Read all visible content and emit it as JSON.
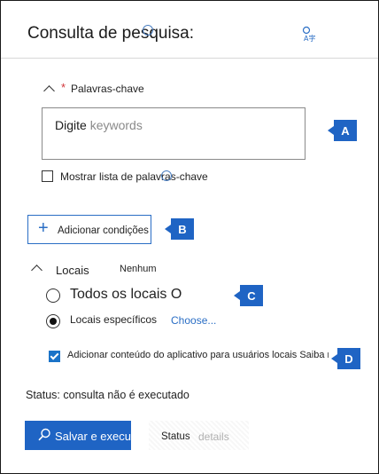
{
  "header": {
    "title": "Consulta de pesquisa:",
    "translate_icon_glyph": "A字"
  },
  "keywords": {
    "label": "Palavras-chave",
    "required_mark": "*",
    "input_prefix": "Digite",
    "input_placeholder": "keywords",
    "show_list_label": "Mostrar lista de palavras-chave"
  },
  "conditions": {
    "add_label": "Adicionar condições"
  },
  "locations": {
    "label": "Locais",
    "value": "Nenhum",
    "all_label": "Todos os locais O",
    "specific_label": "Locais específicos",
    "choose_link": "Choose...",
    "include_app_label": "Adicionar conteúdo do aplicativo para usuários locais Saiba mais"
  },
  "status": {
    "text": "Status: consulta não é executado"
  },
  "footer": {
    "save_label": "Salvar e executar",
    "status_label": "Status",
    "details_label": "details"
  },
  "callouts": {
    "a": "A",
    "b": "B",
    "c": "C",
    "d": "D"
  },
  "colors": {
    "accent": "#1f64c4",
    "required": "#d13438",
    "link": "#2a6ec5"
  },
  "icons": {
    "info": "info-icon",
    "translate": "translate-icon",
    "collapse": "chevron-up-icon",
    "add": "plus-icon",
    "search": "search-icon"
  }
}
